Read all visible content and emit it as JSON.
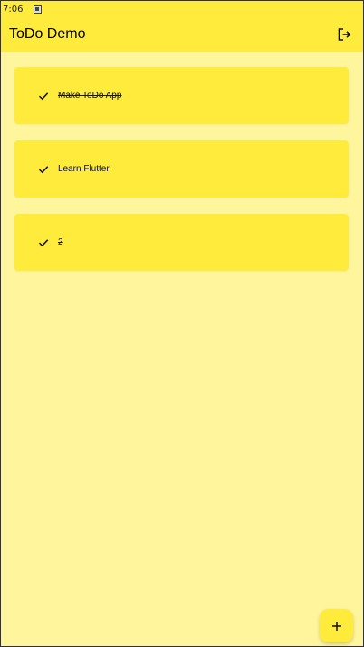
{
  "status_bar": {
    "time": "7:06"
  },
  "app_bar": {
    "title": "ToDo Demo",
    "logout_icon": "logout-icon"
  },
  "todos": [
    {
      "title": "Make ToDo App",
      "done": true
    },
    {
      "title": "Learn Flutter",
      "done": true
    },
    {
      "title": "2",
      "done": true
    }
  ],
  "fab": {
    "icon": "plus-icon"
  },
  "colors": {
    "primary": "#FFEB3B",
    "background": "#FFF59D"
  }
}
